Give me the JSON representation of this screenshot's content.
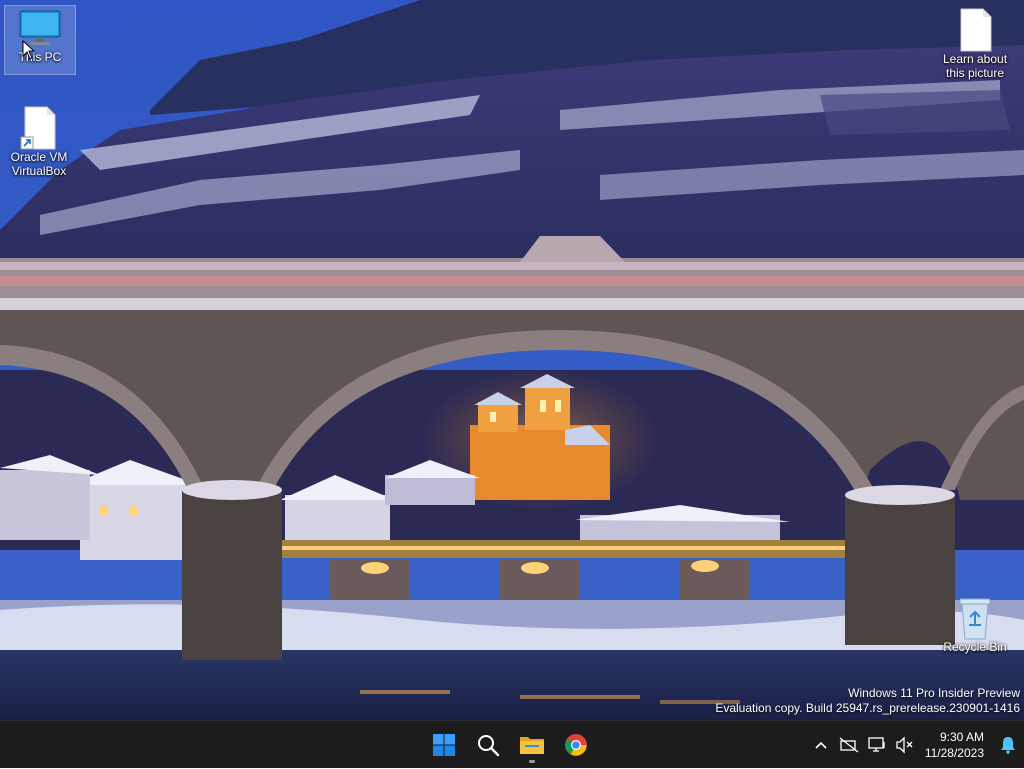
{
  "desktop": {
    "icons": [
      {
        "label": "This PC",
        "icon": "monitor-icon"
      },
      {
        "label": "Oracle VM VirtualBox",
        "icon": "shortcut-file-icon"
      },
      {
        "label": "Learn about this picture",
        "icon": "file-icon"
      },
      {
        "label": "Recycle Bin",
        "icon": "recycle-bin-icon"
      }
    ],
    "watermark": {
      "line1": "Windows 11 Pro Insider Preview",
      "line2": "Evaluation copy. Build 25947.rs_prerelease.230901-1416"
    }
  },
  "taskbar": {
    "pinned": [
      {
        "name": "Start",
        "icon": "windows-logo-icon"
      },
      {
        "name": "Search",
        "icon": "search-icon"
      },
      {
        "name": "File Explorer",
        "icon": "folder-icon"
      },
      {
        "name": "Google Chrome",
        "icon": "chrome-icon"
      }
    ],
    "tray": {
      "icons": [
        "chevron-up-icon",
        "network-disconnected-icon",
        "display-icon",
        "volume-muted-icon"
      ],
      "time": "9:30 AM",
      "date": "11/28/2023",
      "notification_icon": "bell-icon"
    }
  },
  "colors": {
    "taskbar_bg": "#1c1c1c",
    "windows_blue": "#0078d4",
    "folder_yellow": "#f5c342"
  }
}
